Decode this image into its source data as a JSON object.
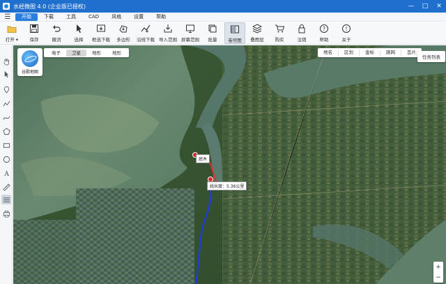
{
  "app": {
    "title": "水经微图 4.0 (企业版已授权)",
    "window_controls": [
      "—",
      "□",
      "✕"
    ]
  },
  "menu": {
    "items": [
      {
        "label": "开始",
        "active": true
      },
      {
        "label": "下载",
        "active": false
      },
      {
        "label": "工具",
        "active": false
      },
      {
        "label": "CAD",
        "active": false
      },
      {
        "label": "风格",
        "active": false
      },
      {
        "label": "设置",
        "active": false
      },
      {
        "label": "帮助",
        "active": false
      }
    ]
  },
  "toolbar": {
    "items": [
      {
        "label": "打开 ▾",
        "icon": "folder-open-icon"
      },
      {
        "label": "保存",
        "icon": "save-icon"
      },
      {
        "label": "撤消",
        "icon": "undo-icon"
      },
      {
        "label": "选择",
        "icon": "select-icon"
      },
      {
        "label": "框选下载",
        "icon": "rect-download-icon"
      },
      {
        "label": "多边形",
        "icon": "polygon-icon"
      },
      {
        "label": "沿线下载",
        "icon": "line-download-icon"
      },
      {
        "label": "导入范围",
        "icon": "import-icon"
      },
      {
        "label": "屏幕范围",
        "icon": "screen-icon"
      },
      {
        "label": "批量",
        "icon": "batch-icon"
      },
      {
        "label": "卷帘图",
        "icon": "swipe-icon",
        "selected": true
      },
      {
        "label": "叠图层",
        "icon": "layers-icon"
      },
      {
        "label": "购买",
        "icon": "cart-icon"
      },
      {
        "label": "注销",
        "icon": "lock-icon"
      },
      {
        "label": "帮助",
        "icon": "help-icon"
      },
      {
        "label": "关于",
        "icon": "info-icon"
      }
    ]
  },
  "map": {
    "source_label": "谷歌地图",
    "type_tabs": [
      {
        "label": "电子",
        "active": false
      },
      {
        "label": "卫星",
        "active": true
      },
      {
        "label": "地形",
        "active": false
      },
      {
        "label": "地形",
        "active": false
      }
    ],
    "overlay_tabs": [
      "地名",
      "区划",
      "金标",
      "路网",
      "瓦片"
    ],
    "task_list_label": "任务列表",
    "tag_name": "屁木",
    "tag_length": "线长度：5.36公里",
    "zoom_in": "+",
    "zoom_out": "−"
  }
}
